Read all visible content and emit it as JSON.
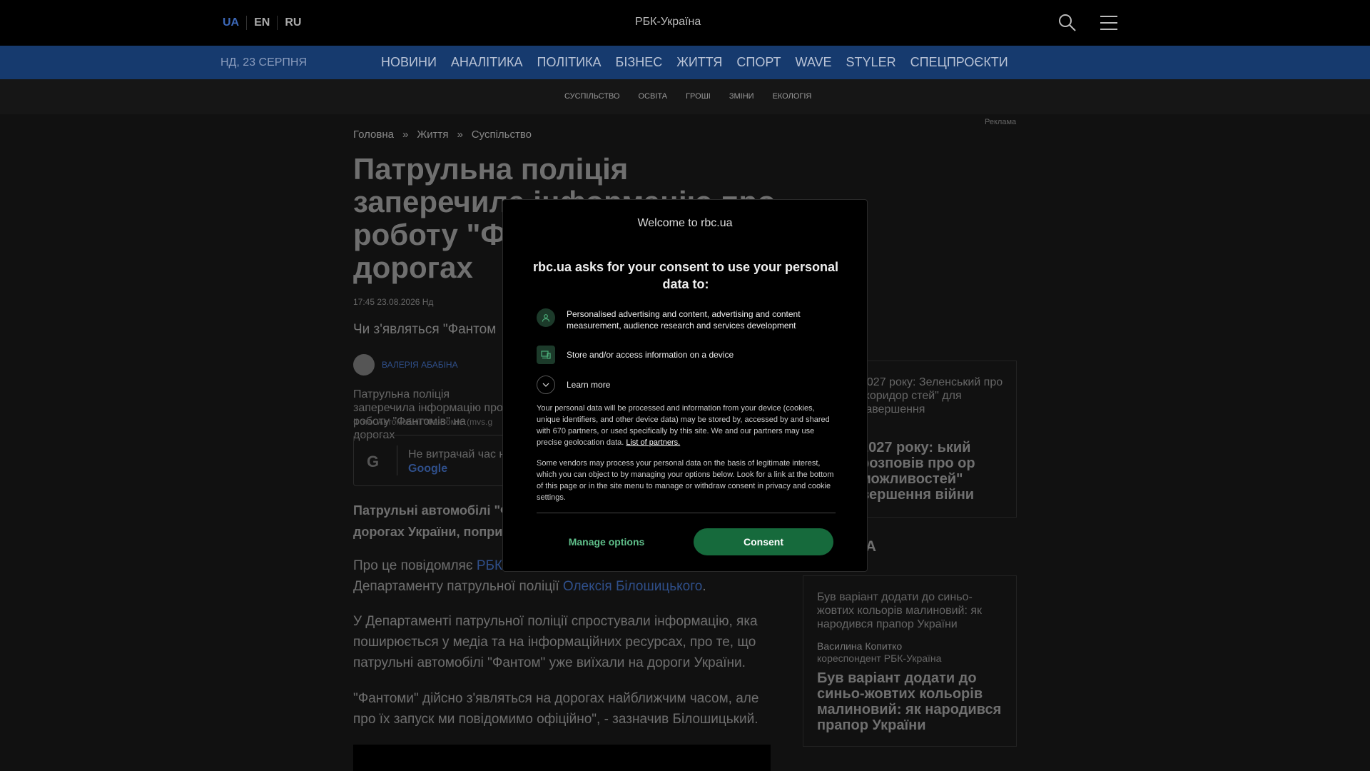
{
  "header": {
    "languages": [
      "UA",
      "EN",
      "RU"
    ],
    "logo_alt": "РБК-Україна",
    "icons": [
      "search-icon",
      "menu-icon"
    ]
  },
  "nav": {
    "date": "НД, 23 СЕРПНЯ",
    "items": [
      "НОВИНИ",
      "АНАЛІТИКА",
      "ПОЛІТИКА",
      "БІЗНЕС",
      "ЖИТТЯ",
      "СПОРТ",
      "WAVE",
      "STYLER",
      "СПЕЦПРОЄКТИ"
    ]
  },
  "subnav": {
    "items": [
      "СУСПІЛЬСТВО",
      "ОСВІТА",
      "ГРОШІ",
      "ЗМІНИ",
      "ЕКОЛОГІЯ"
    ]
  },
  "article": {
    "breadcrumb": [
      "Головна",
      "»",
      "Життя",
      "»",
      "Суспільство"
    ],
    "ad_label": "Реклама",
    "title": "Патрульна поліція заперечила інформацію про роботу \"Фантомів\" на дорогах",
    "meta": "17:45 23.08.2026 Нд",
    "lead": "Чи з'являться \"Фантом",
    "author": "ВАЛЕРІЯ АБАБІНА",
    "image_alt": "Патрульна поліція заперечила інформацію про роботу \"Фантомів\" на дорогах",
    "caption": "Фото: Автомобілі \"Фантоми\" (mvs.g",
    "google_text": "Не витрачай час н",
    "google_link": "Google",
    "bold_paragraph": "Патрульні автомобілі \"Ф дорогах України, попри",
    "p1_a": "Про це повідомляє ",
    "p1_link1": "РБК",
    "p1_b": " Департаменту патрульної поліції ",
    "p1_link2": "Олексія Білошицького",
    "p1_c": ".",
    "p2": "У Департаменті патрульної поліції спростували інформацію, яка поширюється у медіа та на інформаційних ресурсах, про те, що патрульні автомобілі \"Фантом\" уже виїхали на дороги України.",
    "p3": "\"Фантоми\" дійсно з'являться на дорогах найближчим часом, але про їх запуск ми повідомимо офіційно\", - зазначив Білошицький."
  },
  "sidebar": {
    "card1_alt": "2027 року: Зеленський про \"коридор стей\" для завершення",
    "card1_title": "2027 року: ький розповів про ор можливостей\" вершення війни",
    "heading": "КА",
    "card2_alt": "Був варіант додати до синьо-жовтих кольорів малиновий: як народився прапор України",
    "card2_author": "Василина Копитко",
    "card2_role": "кореспондент РБК-Україна",
    "card2_title": "Був варіант додати до синьо-жовтих кольорів малиновий: як народився прапор України"
  },
  "consent": {
    "logo_alt": "Welcome to rbc.ua",
    "title": "rbc.ua asks for your consent to use your personal data to:",
    "purpose1": "Personalised advertising and content, advertising and content measurement, audience research and services development",
    "purpose2": "Store and/or access information on a device",
    "learn_more": "Learn more",
    "text1": "Your personal data will be processed and information from your device (cookies, unique identifiers, and other device data) may be stored by, accessed by and shared with 670 partners, or used specifically by this site. We and our partners may use precise geolocation data.",
    "partners_link": "List of partners.",
    "text2": "Some vendors may process your personal data on the basis of legitimate interest, which you can object to by managing your options below. Look for a link at the bottom of this page or in the site menu to manage or withdraw consent in privacy and cookie settings.",
    "manage_label": "Manage options",
    "consent_label": "Consent",
    "accent_color": "#166a3c"
  }
}
